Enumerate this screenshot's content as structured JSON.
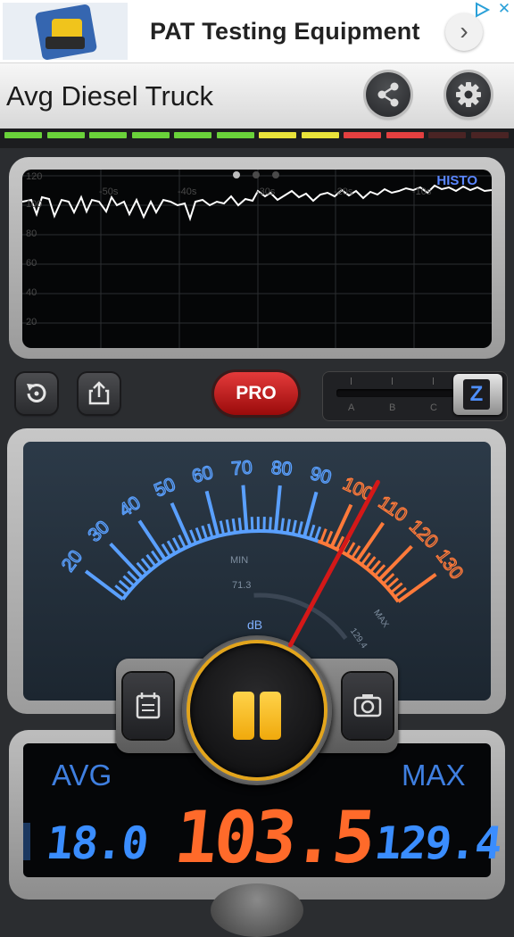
{
  "ad": {
    "title": "PAT Testing Equipment",
    "arrow_icon": "chevron-right-icon",
    "close_glyph": "✕"
  },
  "app": {
    "title": "Avg Diesel Truck",
    "share_icon": "share-icon",
    "settings_icon": "gear-icon"
  },
  "level_strip": {
    "colors": [
      "#6ad23a",
      "#6ad23a",
      "#6ad23a",
      "#6ad23a",
      "#6ad23a",
      "#6ad23a",
      "#e8e23a",
      "#e8e23a",
      "#e34040",
      "#e34040",
      "#4a2424",
      "#4a2424"
    ],
    "lit_segments": 10
  },
  "graph": {
    "label": "HISTO",
    "y_ticks": [
      "120",
      "100",
      "80",
      "60",
      "40",
      "20"
    ],
    "x_ticks": [
      "-50s",
      "-40s",
      "-30s",
      "-20s",
      "-10s"
    ]
  },
  "controls": {
    "pro_label": "PRO",
    "weighting_labels": [
      "A",
      "B",
      "C"
    ],
    "weighting_selected": "Z"
  },
  "gauge": {
    "scale_labels": [
      "20",
      "30",
      "40",
      "50",
      "60",
      "70",
      "80",
      "90",
      "100",
      "110",
      "120",
      "130"
    ],
    "unit": "dB",
    "min_label": "MIN",
    "min_value": "71.3",
    "max_label": "MAX",
    "max_value": "129.4",
    "needle_value": 103.5,
    "range": [
      20,
      130
    ]
  },
  "readout": {
    "avg_label": "AVG",
    "avg_value": "18.0",
    "current_value": "103.5",
    "max_label": "MAX",
    "max_value": "129.4"
  },
  "colors": {
    "blue": "#5aa0ff",
    "orange": "#ff6a2a",
    "needle": "#d41818",
    "pause": "#f5b61a"
  }
}
